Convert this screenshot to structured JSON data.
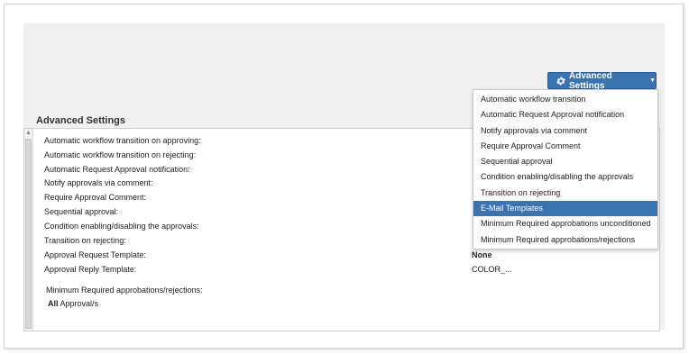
{
  "toolbar": {
    "advanced_settings_button": "Advanced Settings",
    "icon": "gear-icon",
    "caret": "▼"
  },
  "section": {
    "title": "Advanced Settings"
  },
  "settings": [
    {
      "label": "Automatic workflow transition on approving:",
      "value": ""
    },
    {
      "label": "Automatic workflow transition on rejecting:",
      "value": ""
    },
    {
      "label": "Automatic Request Approval notification:",
      "value": ""
    },
    {
      "label": "Notify approvals via comment:",
      "value": ""
    },
    {
      "label": "Require Approval Comment:",
      "value": ""
    },
    {
      "label": "Sequential approval:",
      "value": ""
    },
    {
      "label": "Condition enabling/disabling the approvals:",
      "value": ""
    },
    {
      "label": "Transition on rejecting:",
      "value": ""
    },
    {
      "label": "Approval Request Template:",
      "value": "None"
    },
    {
      "label": "Approval Reply Template:",
      "value": "COLOR_..."
    }
  ],
  "minimum": {
    "label": "Minimum Required approbations/rejections:",
    "value_bold": "All",
    "value_rest": " Approval/s"
  },
  "dropdown": {
    "items": [
      {
        "label": "Automatic workflow transition",
        "active": false
      },
      {
        "label": "Automatic Request Approval notification",
        "active": false
      },
      {
        "label": "Notify approvals via comment",
        "active": false
      },
      {
        "label": "Require Approval Comment",
        "active": false
      },
      {
        "label": "Sequential approval",
        "active": false
      },
      {
        "label": "Condition enabling/disabling the approvals",
        "active": false
      },
      {
        "label": "Transition on rejecting",
        "active": false
      },
      {
        "label": "E-Mail Templates",
        "active": true
      },
      {
        "label": "Minimum Required approbations unconditioned",
        "active": false
      },
      {
        "label": "Minimum Required approbations/rejections",
        "active": false
      }
    ]
  },
  "colors": {
    "accent": "#3b73af",
    "background": "#f0f0f0"
  }
}
